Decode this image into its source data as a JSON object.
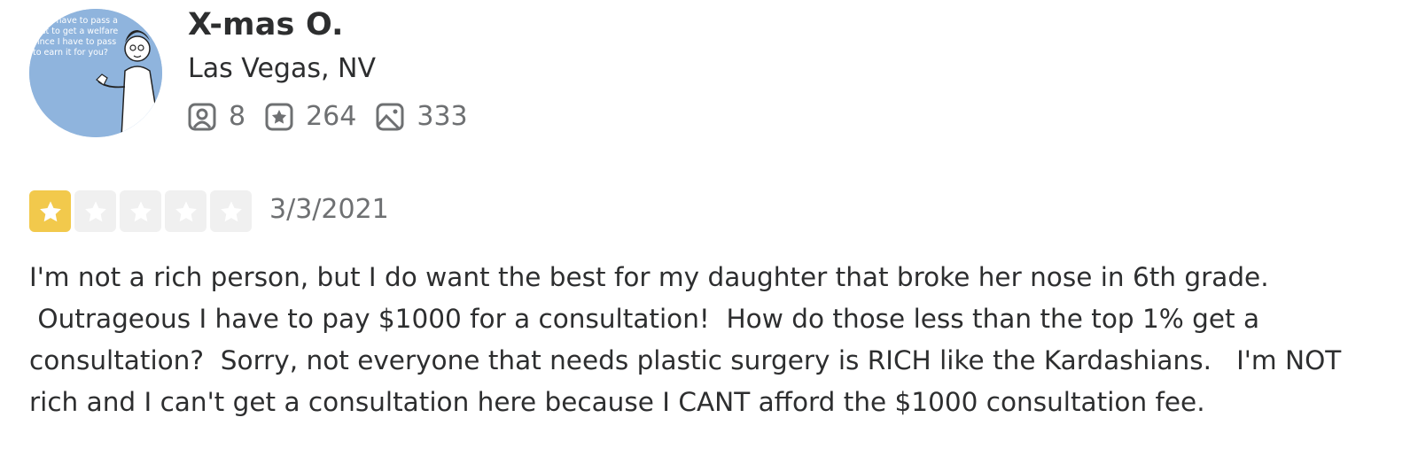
{
  "user": {
    "name": "X-mas O.",
    "location": "Las Vegas, NV",
    "friends_count": "8",
    "reviews_count": "264",
    "photos_count": "333",
    "avatar_text": "you have to pass a test to get a welfare since I have to pass to earn it for you?"
  },
  "review": {
    "rating": 1,
    "rating_max": 5,
    "date": "3/3/2021",
    "text": "I'm not a rich person, but I do want the best for my daughter that broke her nose in 6th grade.\n Outrageous I have to pay $1000 for a consultation!  How do those less than the top 1% get a\nconsultation?  Sorry, not everyone that needs plastic surgery is RICH like the Kardashians.   I'm NOT\nrich and I can't get a consultation here because I CANT afford the $1000 consultation fee."
  },
  "colors": {
    "star_filled": "#f2c94c",
    "star_empty": "#f0f0f0",
    "text_primary": "#2d2e2f",
    "text_secondary": "#6e7072"
  },
  "icons": [
    "friends-icon",
    "review-star-icon",
    "photo-icon",
    "star-icon"
  ]
}
